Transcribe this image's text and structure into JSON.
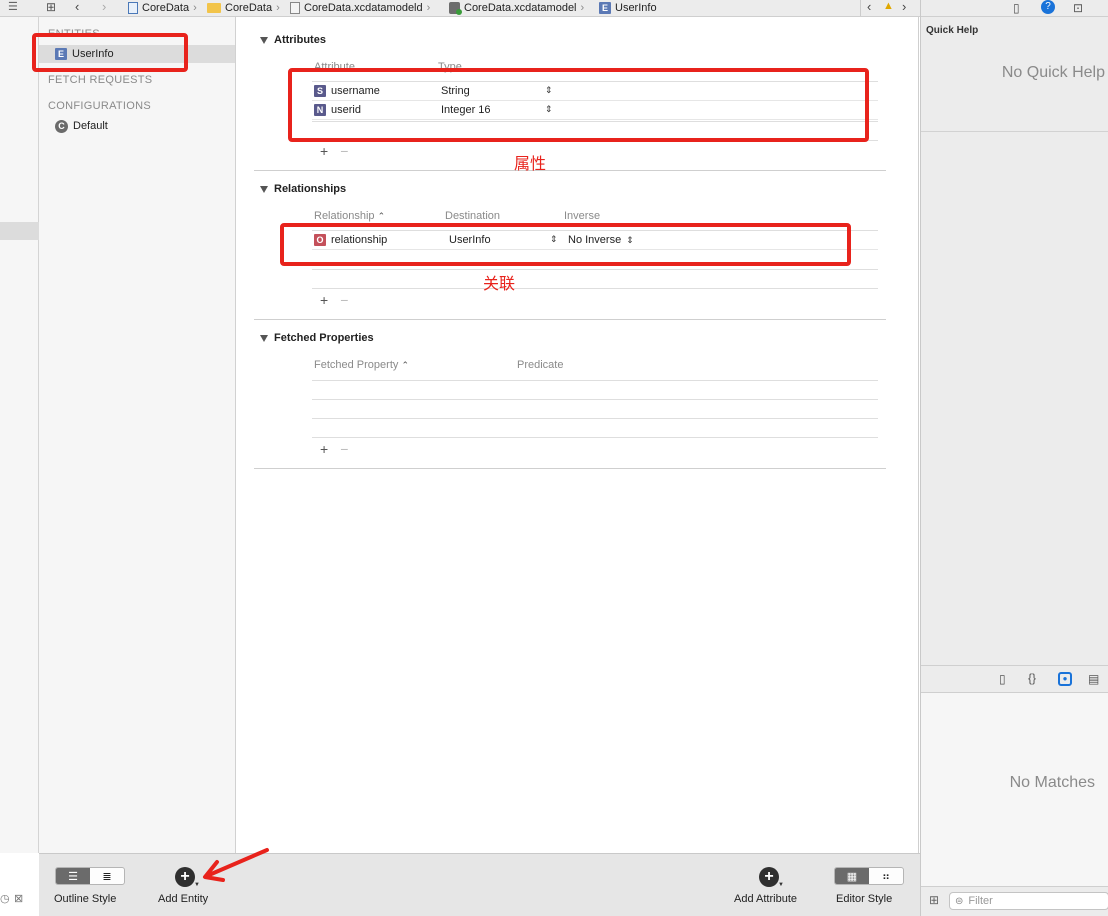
{
  "jumpbar": {
    "crumbs": [
      "CoreData",
      "CoreData",
      "CoreData.xcdatamodeld",
      "CoreData.xcdatamodel",
      "UserInfo"
    ],
    "entity_badge": "E"
  },
  "sidebar": {
    "entities_header": "ENTITIES",
    "entity": {
      "badge": "E",
      "label": "UserInfo"
    },
    "fetch_requests_header": "FETCH REQUESTS",
    "configurations_header": "CONFIGURATIONS",
    "configuration": {
      "badge": "C",
      "label": "Default"
    }
  },
  "attributes": {
    "title": "Attributes",
    "col_attribute": "Attribute",
    "col_type": "Type",
    "rows": [
      {
        "badge": "S",
        "name": "username",
        "type": "String"
      },
      {
        "badge": "N",
        "name": "userid",
        "type": "Integer 16"
      }
    ],
    "plus": "+",
    "minus": "−"
  },
  "relationships": {
    "title": "Relationships",
    "col_relationship": "Relationship",
    "col_destination": "Destination",
    "col_inverse": "Inverse",
    "rows": [
      {
        "badge": "O",
        "name": "relationship",
        "destination": "UserInfo",
        "inverse": "No Inverse"
      }
    ],
    "plus": "+",
    "minus": "−"
  },
  "fetched": {
    "title": "Fetched Properties",
    "col_property": "Fetched Property",
    "col_predicate": "Predicate",
    "plus": "+",
    "minus": "−"
  },
  "annotations": {
    "attr_label": "属性",
    "rel_label": "关联"
  },
  "bottombar": {
    "outline_style": "Outline Style",
    "add_entity": "Add Entity",
    "add_attribute": "Add Attribute",
    "editor_style": "Editor Style"
  },
  "inspector": {
    "quick_help_title": "Quick Help",
    "no_quick_help": "No Quick Help",
    "no_matches": "No Matches",
    "filter_placeholder": "Filter"
  },
  "colors": {
    "annotation_red": "#e8231c",
    "badge_string": "#5a5a8c",
    "badge_relationship": "#c4505a",
    "entity_blue": "#5b79b5",
    "inspector_accent": "#1a73d9"
  }
}
